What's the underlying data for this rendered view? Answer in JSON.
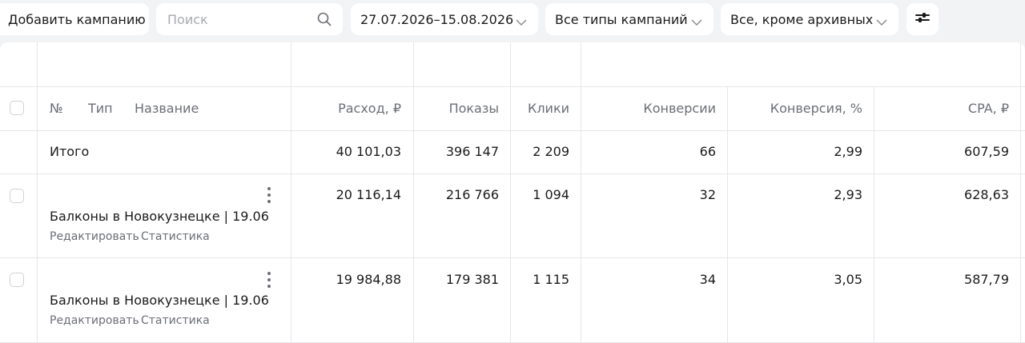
{
  "toolbar": {
    "add_campaign": "Добавить кампанию",
    "search_placeholder": "Поиск",
    "date_range": "27.07.2026–15.08.2026",
    "campaign_types": "Все типы кампаний",
    "status_filter": "Все, кроме архивных"
  },
  "table": {
    "headers": {
      "no": "№",
      "type": "Тип",
      "name": "Название",
      "spend": "Расход, ₽",
      "impressions": "Показы",
      "clicks": "Клики",
      "conversions": "Конверсии",
      "conversion_rate": "Конверсия, %",
      "cpa": "CPA, ₽"
    },
    "total": {
      "label": "Итого",
      "spend": "40 101,03",
      "impressions": "396 147",
      "clicks": "2 209",
      "conversions": "66",
      "conversion_rate": "2,99",
      "cpa": "607,59"
    },
    "rows": [
      {
        "name": "Балконы в Новокузнецке | 19.06",
        "edit": "Редактировать",
        "stats": "Статистика",
        "spend": "20 116,14",
        "impressions": "216 766",
        "clicks": "1 094",
        "conversions": "32",
        "conversion_rate": "2,93",
        "cpa": "628,63"
      },
      {
        "name": "Балконы в Новокузнецке | 19.06",
        "edit": "Редактировать",
        "stats": "Статистика",
        "spend": "19 984,88",
        "impressions": "179 381",
        "clicks": "1 115",
        "conversions": "34",
        "conversion_rate": "3,05",
        "cpa": "587,79"
      }
    ]
  }
}
